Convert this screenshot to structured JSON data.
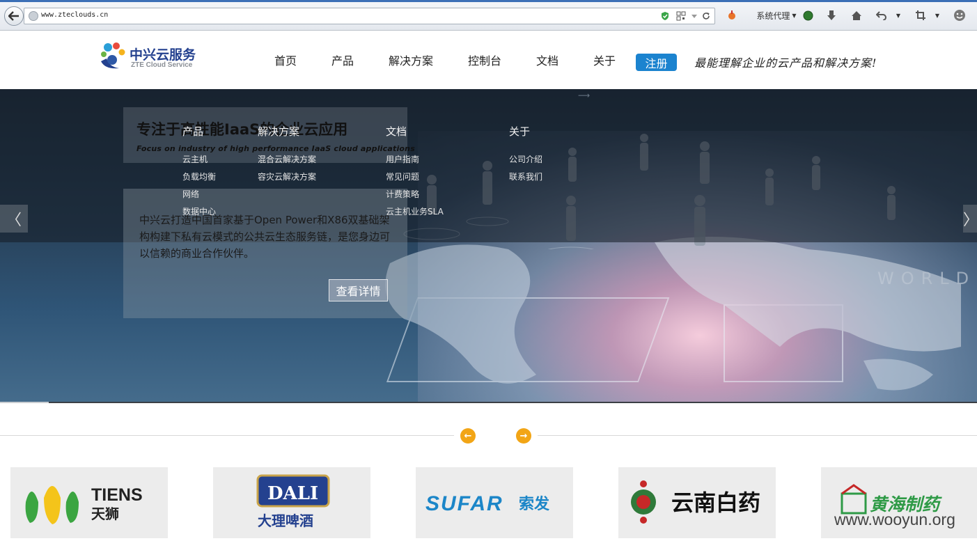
{
  "browser": {
    "url": "www.zteclouds.cn",
    "proxy_label": "系统代理"
  },
  "header": {
    "logo_cn": "中兴云服务",
    "logo_en": "ZTE Cloud Service",
    "nav": [
      "首页",
      "产品",
      "解决方案",
      "控制台",
      "文档",
      "关于"
    ],
    "register": "注册",
    "slogan": "最能理解企业的云产品和解决方案!"
  },
  "hero": {
    "title": "专注于高性能IaaS的企业云应用",
    "subtitle": "Focus on industry of high performance IaaS cloud applications",
    "description": "中兴云打造中国首家基于Open Power和X86双基础架构构建下私有云模式的公共云生态服务链，是您身边可以信赖的商业合作伙伴。",
    "details_button": "查看详情",
    "prev_symbol": "〈",
    "next_symbol": "〉",
    "progress_fraction": 0.05
  },
  "menu": {
    "columns": [
      {
        "title": "产品",
        "items": [
          "云主机",
          "负载均衡",
          "网络",
          "数据中心"
        ]
      },
      {
        "title": "解决方案",
        "items": [
          "混合云解决方案",
          "容灾云解决方案"
        ]
      },
      {
        "title": "文档",
        "items": [
          "用户指南",
          "常见问题",
          "计费策略",
          "云主机业务SLA"
        ]
      },
      {
        "title": "关于",
        "items": [
          "公司介绍",
          "联系我们"
        ]
      }
    ]
  },
  "partners": {
    "logos": [
      {
        "name": "TIENS 天狮",
        "en": "TIENS",
        "cn": "天狮"
      },
      {
        "name": "DALI 大理啤酒",
        "en": "DALI",
        "cn": "大理啤酒"
      },
      {
        "name": "SUFAR 索发",
        "en": "SUFAR",
        "cn": "索发"
      },
      {
        "name": "云南白药",
        "cn": "云南白药"
      },
      {
        "name": "黄海制药",
        "cn": "黄海制药"
      }
    ],
    "watermark": "www.wooyun.org"
  },
  "colors": {
    "brand_blue": "#1b83cf",
    "arrow_orange": "#f2a516",
    "logo_navy": "#24418f"
  }
}
